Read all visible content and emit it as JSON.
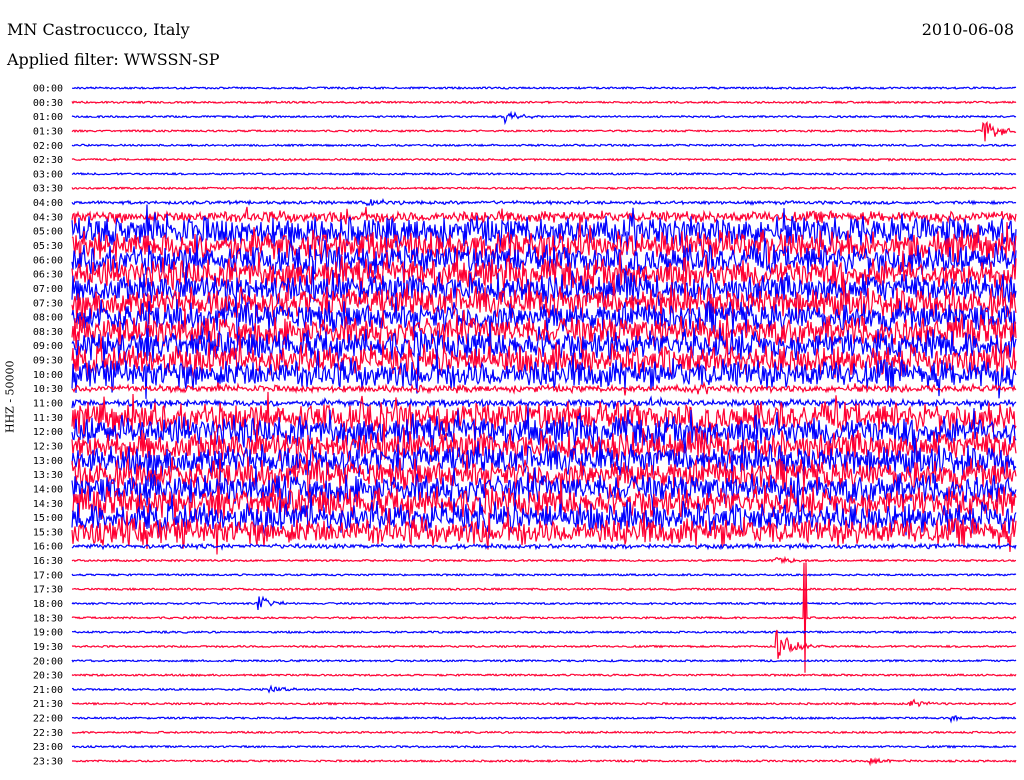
{
  "header": {
    "station": "MN Castrocucco, Italy",
    "date": "2010-06-08",
    "filter": "Applied filter: WWSSN-SP"
  },
  "chart_data": {
    "type": "line",
    "title": "MN Castrocucco, Italy",
    "ylabel": "HHZ - 50000",
    "colors": [
      "#0000ff",
      "#ff0033"
    ],
    "minutes_per_line": 30,
    "labels": [
      "00:00",
      "00:30",
      "01:00",
      "01:30",
      "02:00",
      "02:30",
      "03:00",
      "03:30",
      "04:00",
      "04:30",
      "05:00",
      "05:30",
      "06:00",
      "06:30",
      "07:00",
      "07:30",
      "08:00",
      "08:30",
      "09:00",
      "09:30",
      "10:00",
      "10:30",
      "11:00",
      "11:30",
      "12:00",
      "12:30",
      "13:00",
      "13:30",
      "14:00",
      "14:30",
      "15:00",
      "15:30",
      "16:00",
      "16:30",
      "17:00",
      "17:30",
      "18:00",
      "18:30",
      "19:00",
      "19:30",
      "20:00",
      "20:30",
      "21:00",
      "21:30",
      "22:00",
      "22:30",
      "23:00",
      "23:30"
    ],
    "noise_level": [
      1,
      1,
      1,
      1,
      1,
      1,
      1,
      1,
      1.5,
      5,
      13,
      13,
      13,
      13,
      13,
      13,
      13,
      13,
      13,
      13,
      13,
      3,
      3,
      13,
      13,
      13,
      13,
      13,
      13,
      13,
      13,
      12,
      2,
      1,
      1,
      1,
      1,
      1,
      1,
      1,
      1,
      1,
      1,
      1,
      1,
      1,
      1,
      1
    ],
    "events": [
      {
        "line": 2,
        "minute": 13.9,
        "amp": 6
      },
      {
        "line": 3,
        "minute": 29.1,
        "amp": 12
      },
      {
        "line": 8,
        "minute": 9.5,
        "amp": 4
      },
      {
        "line": 33,
        "minute": 22.5,
        "amp": 4
      },
      {
        "line": 36,
        "minute": 6,
        "amp": 7
      },
      {
        "line": 39,
        "minute": 22.5,
        "amp": 18
      },
      {
        "line": 37,
        "minute": 23.3,
        "amp": 55,
        "spike": true
      },
      {
        "line": 42,
        "minute": 6.4,
        "amp": 4
      },
      {
        "line": 43,
        "minute": 26.7,
        "amp": 4
      },
      {
        "line": 44,
        "minute": 28,
        "amp": 3
      },
      {
        "line": 47,
        "minute": 25.5,
        "amp": 3
      }
    ]
  }
}
